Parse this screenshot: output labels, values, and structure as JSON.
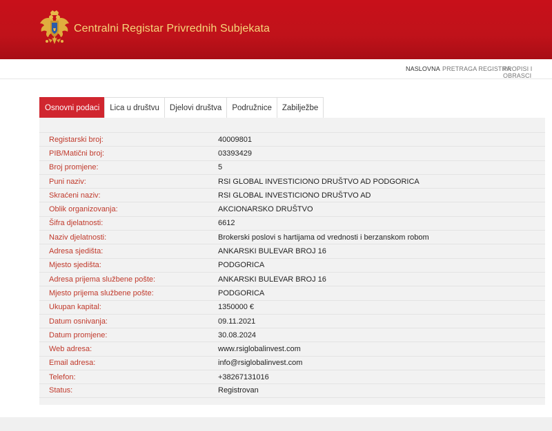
{
  "header": {
    "title": "Centralni Registar Privrednih Subjekata",
    "logo_icon": "montenegro-coat-of-arms-icon",
    "bg_color": "#c0121a",
    "title_color": "#f6d77a"
  },
  "nav": {
    "items": [
      "NASLOVNA",
      "PRETRAGA REGISTRA",
      "PROPISI I OBRASCI"
    ]
  },
  "tabs": [
    "Osnovni podaci",
    "Lica u društvu",
    "Djelovi društva",
    "Podružnice",
    "Zabilježbe"
  ],
  "active_tab": "Osnovni podaci",
  "details": [
    {
      "label": "Registarski broj:",
      "value": "40009801"
    },
    {
      "label": "PIB/Matični broj:",
      "value": "03393429"
    },
    {
      "label": "Broj promjene:",
      "value": "5"
    },
    {
      "label": "Puni naziv:",
      "value": "RSI GLOBAL INVESTICIONO DRUŠTVO AD PODGORICA"
    },
    {
      "label": "Skraćeni naziv:",
      "value": "RSI GLOBAL INVESTICIONO DRUŠTVO AD"
    },
    {
      "label": "Oblik organizovanja:",
      "value": "AKCIONARSKO DRUŠTVO"
    },
    {
      "label": "Šifra djelatnosti:",
      "value": "6612"
    },
    {
      "label": "Naziv djelatnosti:",
      "value": "Brokerski poslovi s hartijama od vrednosti i berzanskom robom"
    },
    {
      "label": "Adresa sjedišta:",
      "value": "ANKARSKI BULEVAR BROJ 16"
    },
    {
      "label": "Mjesto sjedišta:",
      "value": "PODGORICA"
    },
    {
      "label": "Adresa prijema službene pošte:",
      "value": "ANKARSKI BULEVAR BROJ 16"
    },
    {
      "label": "Mjesto prijema službene pošte:",
      "value": "PODGORICA"
    },
    {
      "label": "Ukupan kapital:",
      "value": "1350000 €"
    },
    {
      "label": "Datum osnivanja:",
      "value": "09.11.2021"
    },
    {
      "label": "Datum promjene:",
      "value": "30.08.2024"
    },
    {
      "label": "Web adresa:",
      "value": "www.rsiglobalinvest.com"
    },
    {
      "label": "Email adresa:",
      "value": "info@rsiglobalinvest.com"
    },
    {
      "label": "Telefon:",
      "value": "+38267131016"
    },
    {
      "label": "Status:",
      "value": "Registrovan"
    }
  ]
}
